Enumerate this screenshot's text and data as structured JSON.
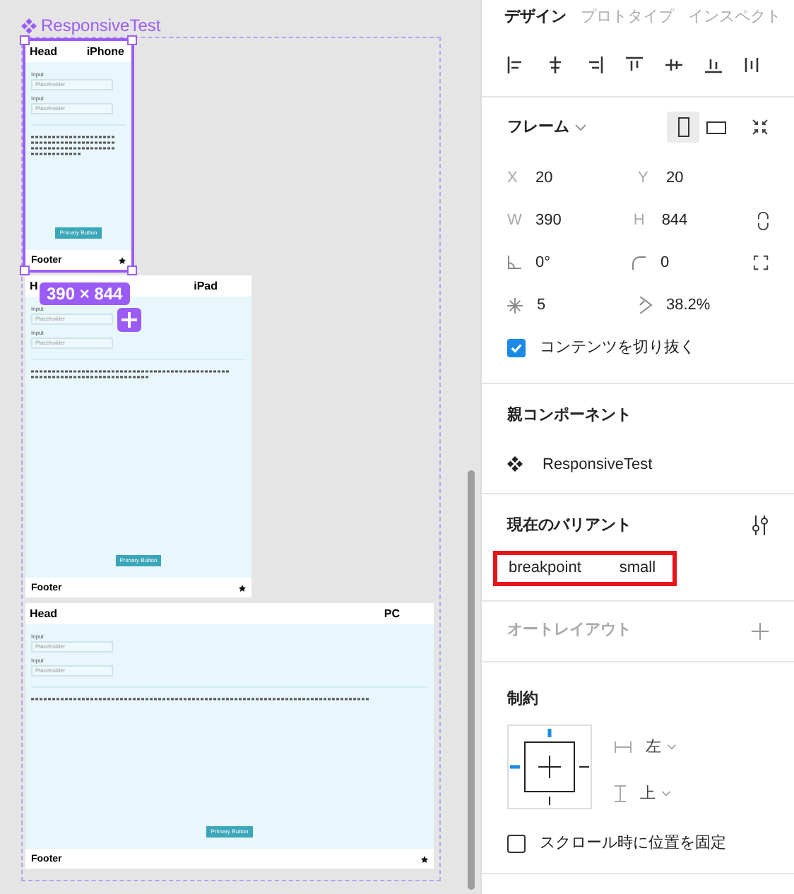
{
  "canvas": {
    "component_title": "ResponsiveTest",
    "size_badge": "390 × 844",
    "frames": [
      {
        "kind": "phone",
        "selected": true,
        "head": "Head",
        "device": "iPhone",
        "fields": [
          {
            "label": "Input",
            "placeholder": "Placeholder"
          },
          {
            "label": "Input",
            "placeholder": "Placeholder"
          }
        ],
        "button": "Primary Button",
        "footer": "Footer"
      },
      {
        "kind": "tablet",
        "selected": false,
        "head": "H",
        "device": "iPad",
        "fields": [
          {
            "label": "Input",
            "placeholder": "Placeholder"
          },
          {
            "label": "Input",
            "placeholder": "Placeholder"
          }
        ],
        "button": "Primary Button",
        "footer": "Footer"
      },
      {
        "kind": "desktop",
        "selected": false,
        "head": "Head",
        "device": "PC",
        "fields": [
          {
            "label": "Input",
            "placeholder": "Placeholder"
          },
          {
            "label": "Input",
            "placeholder": "Placeholder"
          }
        ],
        "button": "Primary Button",
        "footer": "Footer"
      }
    ]
  },
  "panel": {
    "tabs": [
      {
        "label": "デザイン",
        "selected": true
      },
      {
        "label": "プロトタイプ",
        "selected": false
      },
      {
        "label": "インスペクト",
        "selected": false
      }
    ],
    "frame": {
      "title": "フレーム",
      "orientation": [
        {
          "kind": "portrait",
          "selected": true
        },
        {
          "kind": "landscape",
          "selected": false
        }
      ],
      "rows": [
        {
          "kind": "position",
          "cells": [
            {
              "label": "X",
              "value": "20"
            },
            {
              "label": "Y",
              "value": "20"
            }
          ]
        },
        {
          "kind": "size",
          "cells": [
            {
              "label": "W",
              "value": "390"
            },
            {
              "label": "H",
              "value": "844"
            }
          ]
        },
        {
          "kind": "transform",
          "cells": [
            {
              "value": "0°"
            },
            {
              "value": "0"
            }
          ]
        },
        {
          "kind": "star",
          "cells": [
            {
              "value": "5"
            },
            {
              "value": "38.2%"
            }
          ]
        }
      ],
      "clip": {
        "label": "コンテンツを切り抜く",
        "checked": true
      }
    },
    "parent": {
      "title": "親コンポーネント",
      "name": "ResponsiveTest"
    },
    "variant": {
      "title": "現在のバリアント",
      "property": "breakpoint",
      "value": "small",
      "highlighted": true
    },
    "auto_layout": {
      "title": "オートレイアウト"
    },
    "constraints": {
      "title": "制約",
      "horizontal": "左",
      "vertical": "上",
      "fix": {
        "label": "スクロール時に位置を固定",
        "checked": false
      }
    }
  }
}
